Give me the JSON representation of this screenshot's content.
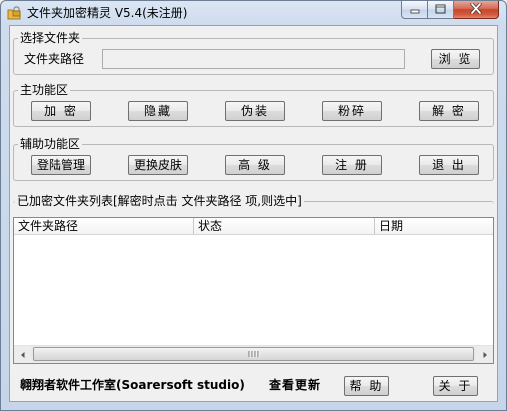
{
  "window": {
    "title": "文件夹加密精灵 V5.4(未注册)"
  },
  "select_group": {
    "legend": "选择文件夹",
    "path_label": "文件夹路径",
    "path_value": "",
    "browse_label": "浏 览"
  },
  "main_group": {
    "legend": "主功能区",
    "buttons": [
      "加 密",
      "隐藏",
      "伪装",
      "粉碎",
      "解 密"
    ]
  },
  "aux_group": {
    "legend": "辅助功能区",
    "buttons": [
      "登陆管理",
      "更换皮肤",
      "高 级",
      "注 册",
      "退 出"
    ]
  },
  "list_group": {
    "legend": "已加密文件夹列表[解密时点击 文件夹路径 项,则选中]",
    "columns": [
      "文件夹路径",
      "状态",
      "日期"
    ],
    "rows": []
  },
  "footer": {
    "studio": "翱翔者软件工作室(Soarersoft studio)",
    "check_update": "查看更新",
    "help_label": "帮 助",
    "about_label": "关 于"
  }
}
